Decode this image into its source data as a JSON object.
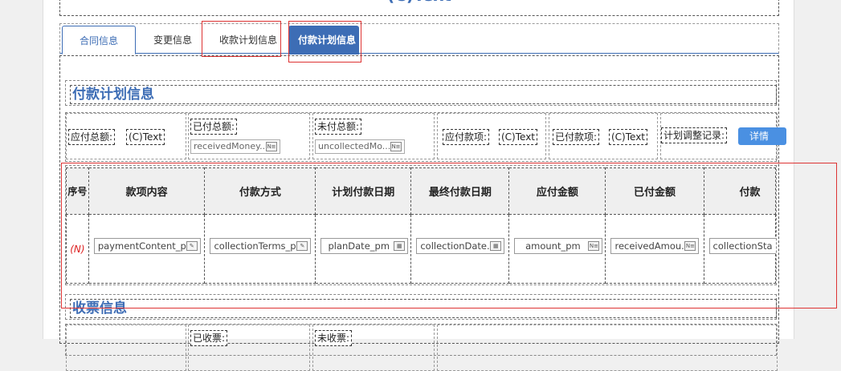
{
  "header": {
    "title": "(C)Text"
  },
  "tabs": [
    {
      "label": "合同信息"
    },
    {
      "label": "变更信息"
    },
    {
      "label": "收款计划信息"
    },
    {
      "label": "付款计划信息"
    }
  ],
  "payment_section": {
    "title": "付款计划信息",
    "total_payable_label": "应付总额:",
    "total_payable_value": "(C)Text",
    "total_paid_label": "已付总额:",
    "total_paid_field": "receivedMoney...",
    "total_unpaid_label": "未付总额:",
    "total_unpaid_field": "uncollectedMo...",
    "payable_items_label": "应付款项:",
    "payable_items_value": "(C)Text",
    "paid_items_label": "已付款项:",
    "paid_items_value": "(C)Text",
    "adjust_record_label": "计划调整记录:",
    "detail_button": "详情"
  },
  "grid": {
    "columns": [
      "序号",
      "款项内容",
      "付款方式",
      "计划付款日期",
      "最终付款日期",
      "应付金额",
      "已付金额",
      "付款"
    ],
    "row_number": "(N)",
    "cells": [
      "paymentContent_pm",
      "collectionTerms_pm",
      "planDate_pm",
      "collectionDate...",
      "amount_pm",
      "receivedAmou...",
      "collectionSta"
    ]
  },
  "invoice_section": {
    "title": "收票信息",
    "received_label": "已收票:",
    "unreceived_label": "未收票:"
  },
  "colors": {
    "accent": "#3d6db5",
    "highlight": "#dd3333",
    "button": "#4a90e2"
  }
}
